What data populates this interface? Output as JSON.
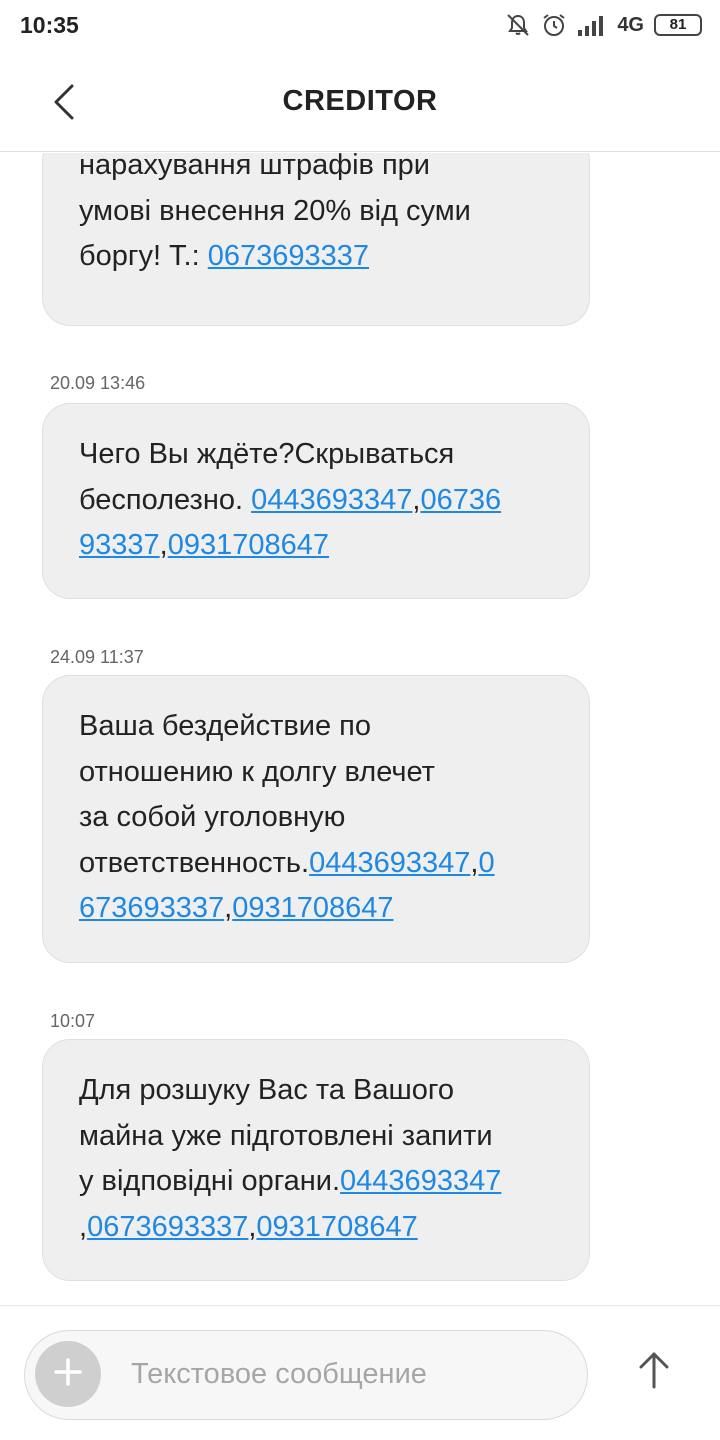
{
  "status_bar": {
    "time": "10:35",
    "network": "4G",
    "battery": "81",
    "icons": [
      "mute-icon",
      "alarm-icon",
      "signal-icon"
    ]
  },
  "header": {
    "title": "CREDITOR",
    "back_icon": "chevron-left-icon"
  },
  "messages": [
    {
      "time": "",
      "parts": [
        {
          "text": "нарахування штрафів при"
        },
        {
          "br": true
        },
        {
          "text": "умові внесення 20% від суми"
        },
        {
          "br": true
        },
        {
          "text": "боргу! Т.: "
        },
        {
          "link": "0673693337"
        }
      ]
    },
    {
      "time": "20.09 13:46",
      "parts": [
        {
          "text": "Чего Вы ждёте?Скрываться"
        },
        {
          "br": true
        },
        {
          "text": "бесполезно. "
        },
        {
          "link": "0443693347"
        },
        {
          "text": ","
        },
        {
          "link": "06736"
        },
        {
          "br": true
        },
        {
          "link": "93337"
        },
        {
          "text": ","
        },
        {
          "link": "0931708647"
        }
      ]
    },
    {
      "time": "24.09 11:37",
      "parts": [
        {
          "text": "Ваша бездействие по"
        },
        {
          "br": true
        },
        {
          "text": "отношению к долгу влечет"
        },
        {
          "br": true
        },
        {
          "text": "за собой уголовную"
        },
        {
          "br": true
        },
        {
          "text": "ответственность."
        },
        {
          "link": "0443693347"
        },
        {
          "text": ","
        },
        {
          "link": "0"
        },
        {
          "br": true
        },
        {
          "link": "673693337"
        },
        {
          "text": ","
        },
        {
          "link": "0931708647"
        }
      ]
    },
    {
      "time": "10:07",
      "parts": [
        {
          "text": "Для розшуку Вас та Вашого"
        },
        {
          "br": true
        },
        {
          "text": "майна уже підготовлені запити"
        },
        {
          "br": true
        },
        {
          "text": "у відповідні органи."
        },
        {
          "link": "0443693347"
        },
        {
          "br": true
        },
        {
          "text": ","
        },
        {
          "link": "0673693337"
        },
        {
          "text": ","
        },
        {
          "link": "0931708647"
        }
      ]
    }
  ],
  "composer": {
    "placeholder": "Текстовое сообщение",
    "add_icon": "plus-icon",
    "send_icon": "arrow-up-icon"
  },
  "colors": {
    "link": "#1e88e5",
    "bubble": "#efefef",
    "timestamp": "#666666"
  }
}
